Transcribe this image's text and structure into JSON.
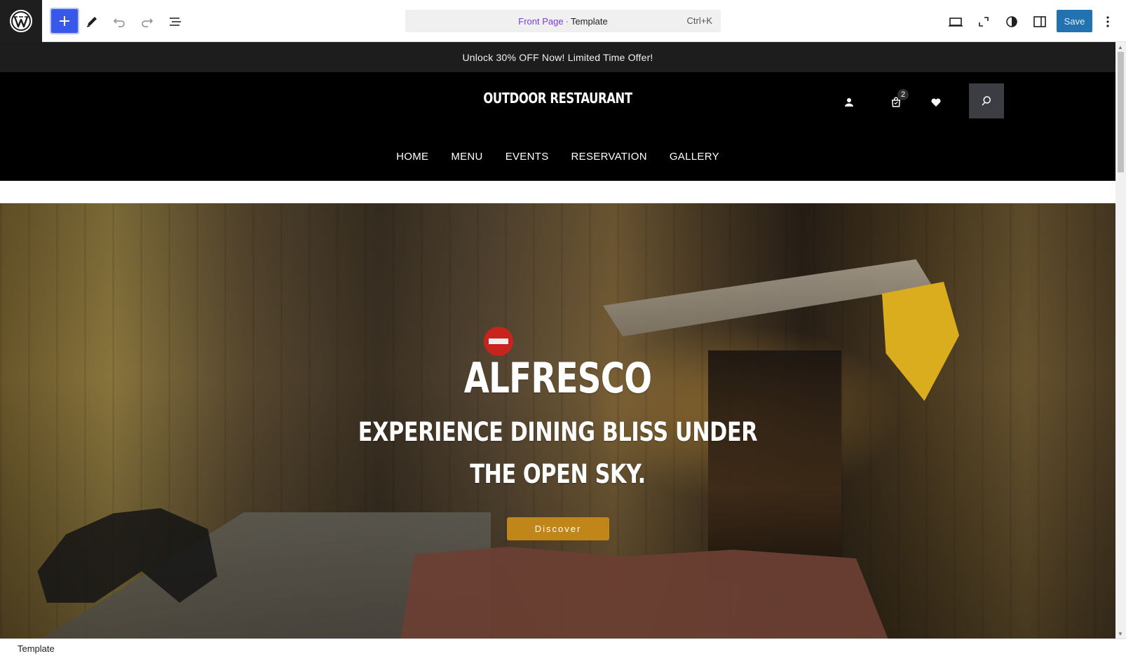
{
  "editor": {
    "command_bar": {
      "page": "Front Page",
      "separator": "·",
      "type": "Template",
      "shortcut": "Ctrl+K"
    },
    "save_label": "Save",
    "icons": [
      "wordpress-logo",
      "plus-icon",
      "pencil-icon",
      "undo-icon",
      "redo-icon",
      "list-view-icon",
      "desktop-view-icon",
      "fullscreen-icon",
      "contrast-icon",
      "sidebar-icon",
      "more-options-icon"
    ]
  },
  "site": {
    "promo": "Unlock 30% OFF Now! Limited Time Offer!",
    "title": "OUTDOOR RESTAURANT",
    "cart_count": "2",
    "nav": [
      "HOME",
      "MENU",
      "EVENTS",
      "RESERVATION",
      "GALLERY"
    ],
    "hero": {
      "title": "ALFRESCO",
      "subtitle_line1": "EXPERIENCE DINING BLISS UNDER",
      "subtitle_line2": "THE OPEN SKY.",
      "button": "Discover"
    }
  },
  "footer": {
    "breadcrumb": "Template"
  },
  "colors": {
    "primary": "#3858e9",
    "save": "#2271b1",
    "accent": "#c1861a",
    "header_bg": "#000000",
    "promo_bg": "#1d1d1d"
  }
}
